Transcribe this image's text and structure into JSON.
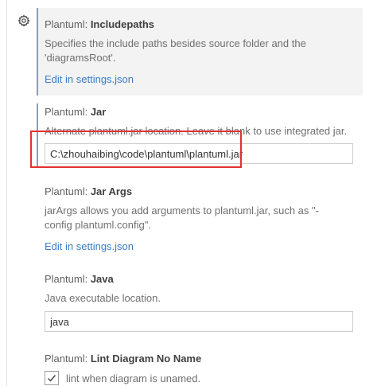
{
  "settings": [
    {
      "category": "Plantuml: ",
      "key": "Includepaths",
      "description": "Specifies the include paths besides source folder and the 'diagramsRoot'.",
      "link": "Edit in settings.json"
    },
    {
      "category": "Plantuml: ",
      "key": "Jar",
      "description": "Alternate plantuml.jar location. Leave it blank to use integrated jar.",
      "value": "C:\\zhouhaibing\\code\\plantuml\\plantuml.jar"
    },
    {
      "category": "Plantuml: ",
      "key": "Jar Args",
      "description": "jarArgs allows you add arguments to plantuml.jar, such as \"-config plantuml.config\".",
      "link": "Edit in settings.json"
    },
    {
      "category": "Plantuml: ",
      "key": "Java",
      "description": "Java executable location.",
      "value": "java"
    },
    {
      "category": "Plantuml: ",
      "key": "Lint Diagram No Name",
      "checkbox_label": "lint when diagram is unamed.",
      "checked": true
    }
  ],
  "icons": {
    "gear": "gear-icon",
    "check": "check-icon"
  },
  "colors": {
    "focused_background": "#f3f3f3",
    "modified_indicator": "#73a3d6",
    "link": "#3a7cc4",
    "annotation_box": "#e03232"
  }
}
